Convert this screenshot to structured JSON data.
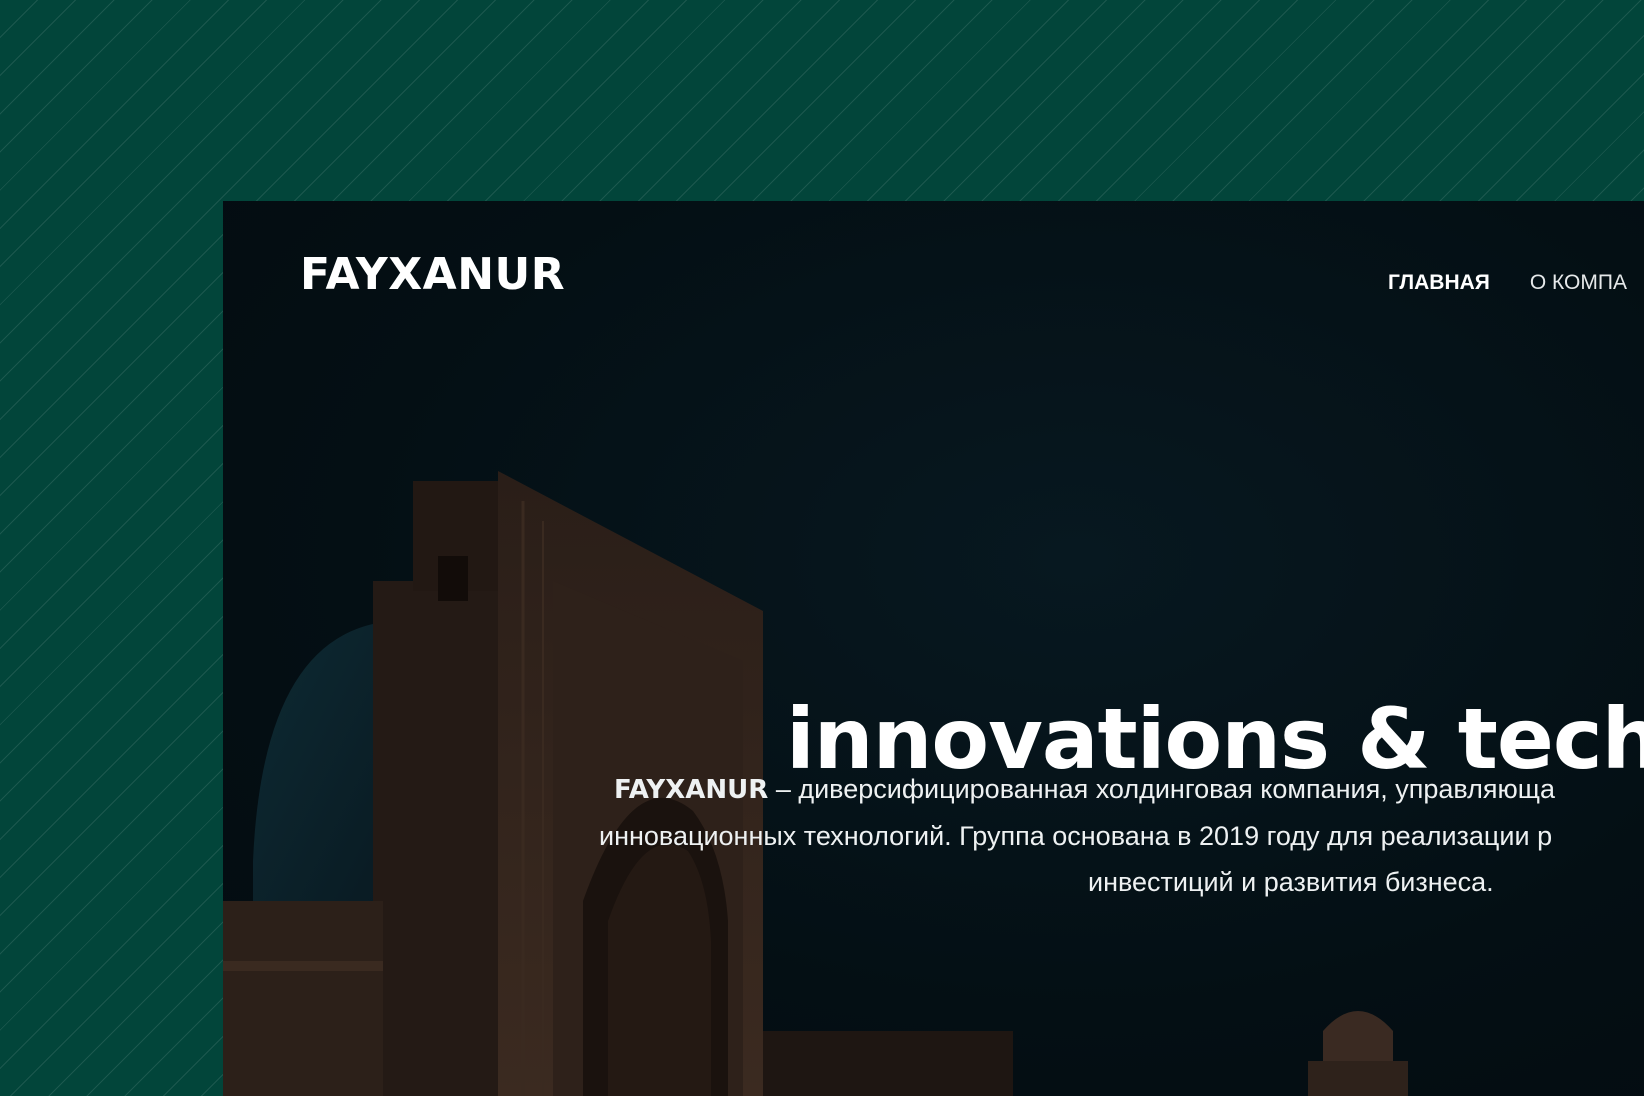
{
  "brand": {
    "logo": "FAYXANUR"
  },
  "nav": {
    "items": [
      {
        "label": "ГЛАВНАЯ",
        "active": true
      },
      {
        "label": "О КОМПА",
        "active": false
      }
    ]
  },
  "hero": {
    "title": "innovations & techno",
    "brand_word": "FAYXANUR",
    "line1_rest": " – диверсифицированная холдинговая компания, управляюща",
    "line2": "инновационных технологий. Группа основана в 2019 году для реализации р",
    "line3": "инвестиций и развития бизнеса."
  },
  "colors": {
    "outer_background": "#02453a",
    "site_background": "#040f14",
    "text": "#ffffff"
  }
}
